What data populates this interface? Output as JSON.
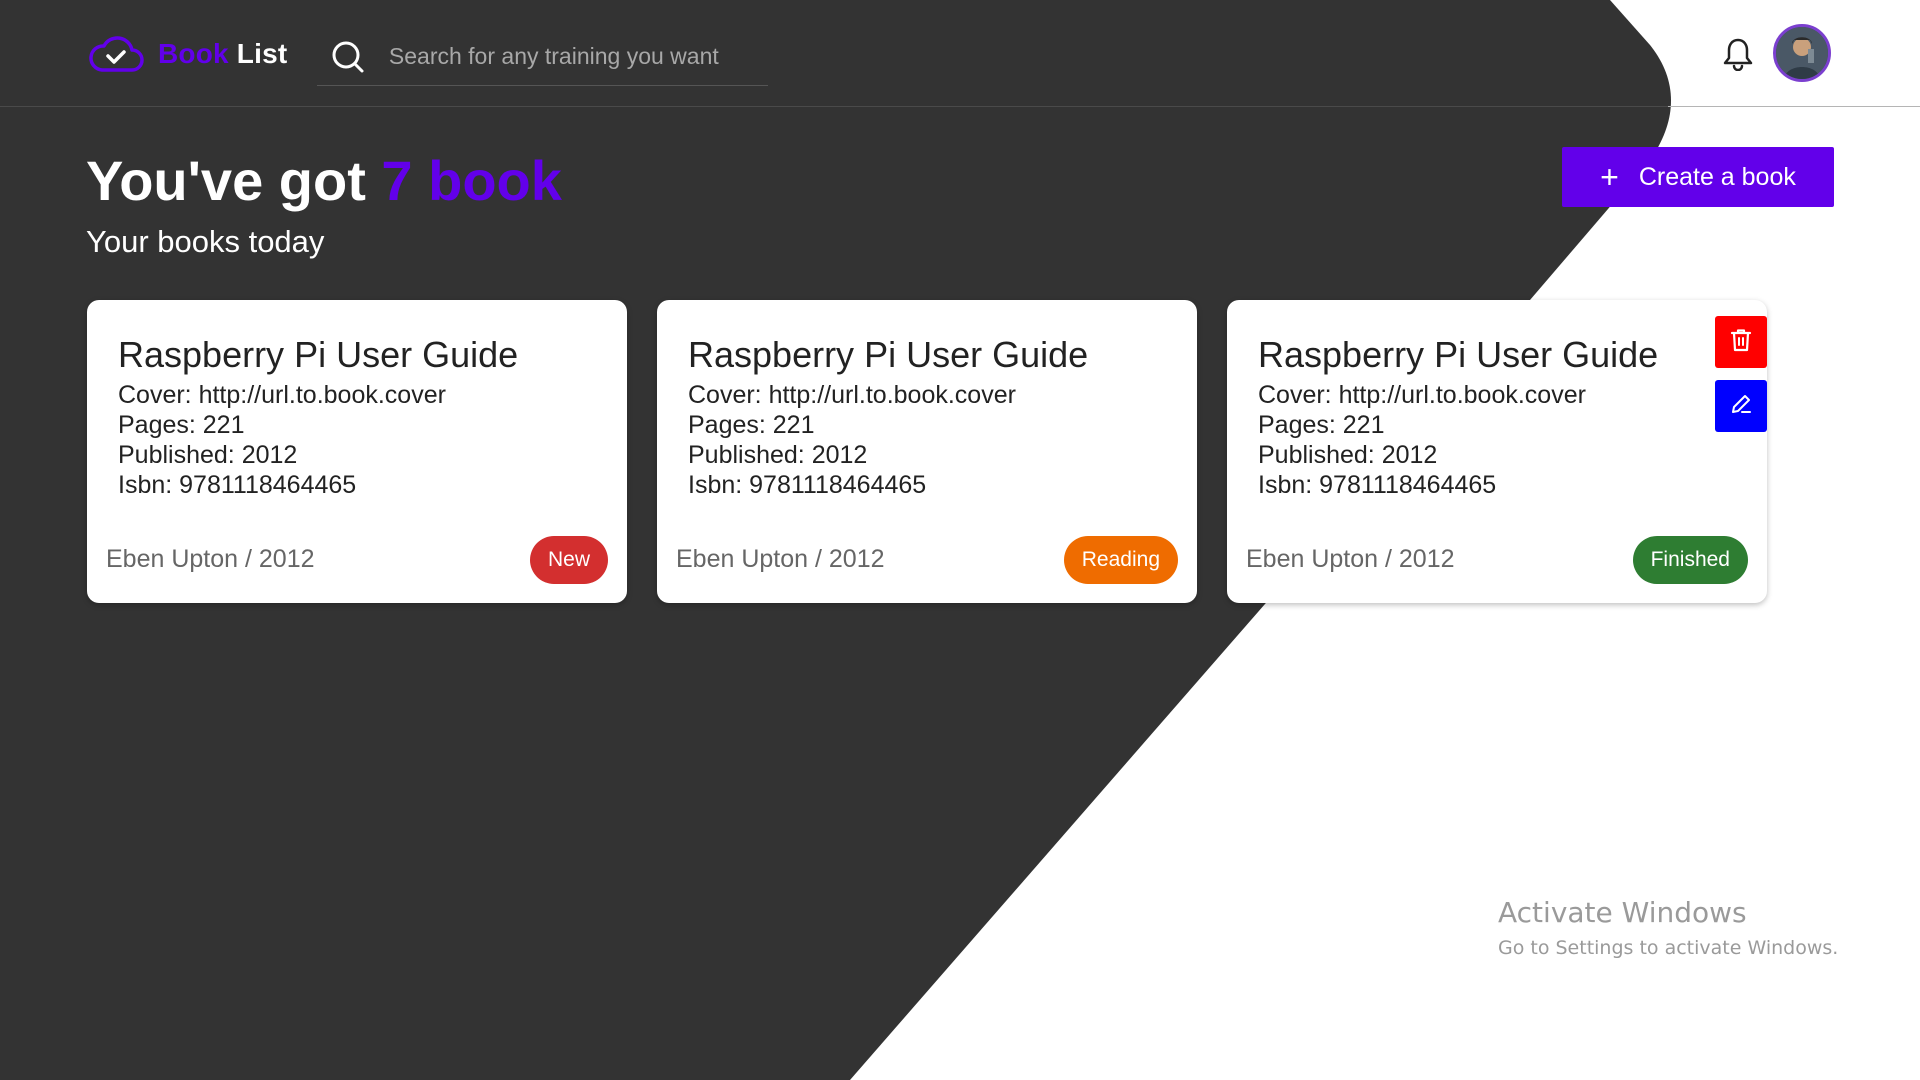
{
  "header": {
    "logo_book": "Book",
    "logo_list": "List",
    "search_placeholder": "Search for any training you want"
  },
  "hero": {
    "title_prefix": "You've got ",
    "title_highlight": "7 book",
    "subtitle": "Your books today",
    "create_button": "Create a book"
  },
  "books": [
    {
      "title": "Raspberry Pi User Guide",
      "cover": "Cover: http://url.to.book.cover",
      "pages": "Pages: 221",
      "published": "Published: 2012",
      "isbn": "Isbn: 9781118464465",
      "author_year": "Eben Upton / 2012",
      "status": "New"
    },
    {
      "title": "Raspberry Pi User Guide",
      "cover": "Cover: http://url.to.book.cover",
      "pages": "Pages: 221",
      "published": "Published: 2012",
      "isbn": "Isbn: 9781118464465",
      "author_year": "Eben Upton / 2012",
      "status": "Reading"
    },
    {
      "title": "Raspberry Pi User Guide",
      "cover": "Cover: http://url.to.book.cover",
      "pages": "Pages: 221",
      "published": "Published: 2012",
      "isbn": "Isbn: 9781118464465",
      "author_year": "Eben Upton / 2012",
      "status": "Finished"
    }
  ],
  "watermark": {
    "title": "Activate Windows",
    "subtitle": "Go to Settings to activate Windows."
  },
  "colors": {
    "accent": "#6200ea",
    "dark_bg": "#333333",
    "status_new": "#d32f2f",
    "status_reading": "#ef6c00",
    "status_finished": "#2e7d32",
    "delete": "#ff0000",
    "edit": "#0000ff"
  },
  "icons": [
    "cloud-check-icon",
    "search-icon",
    "bell-icon",
    "avatar",
    "plus-icon",
    "trash-icon",
    "pen-icon"
  ]
}
